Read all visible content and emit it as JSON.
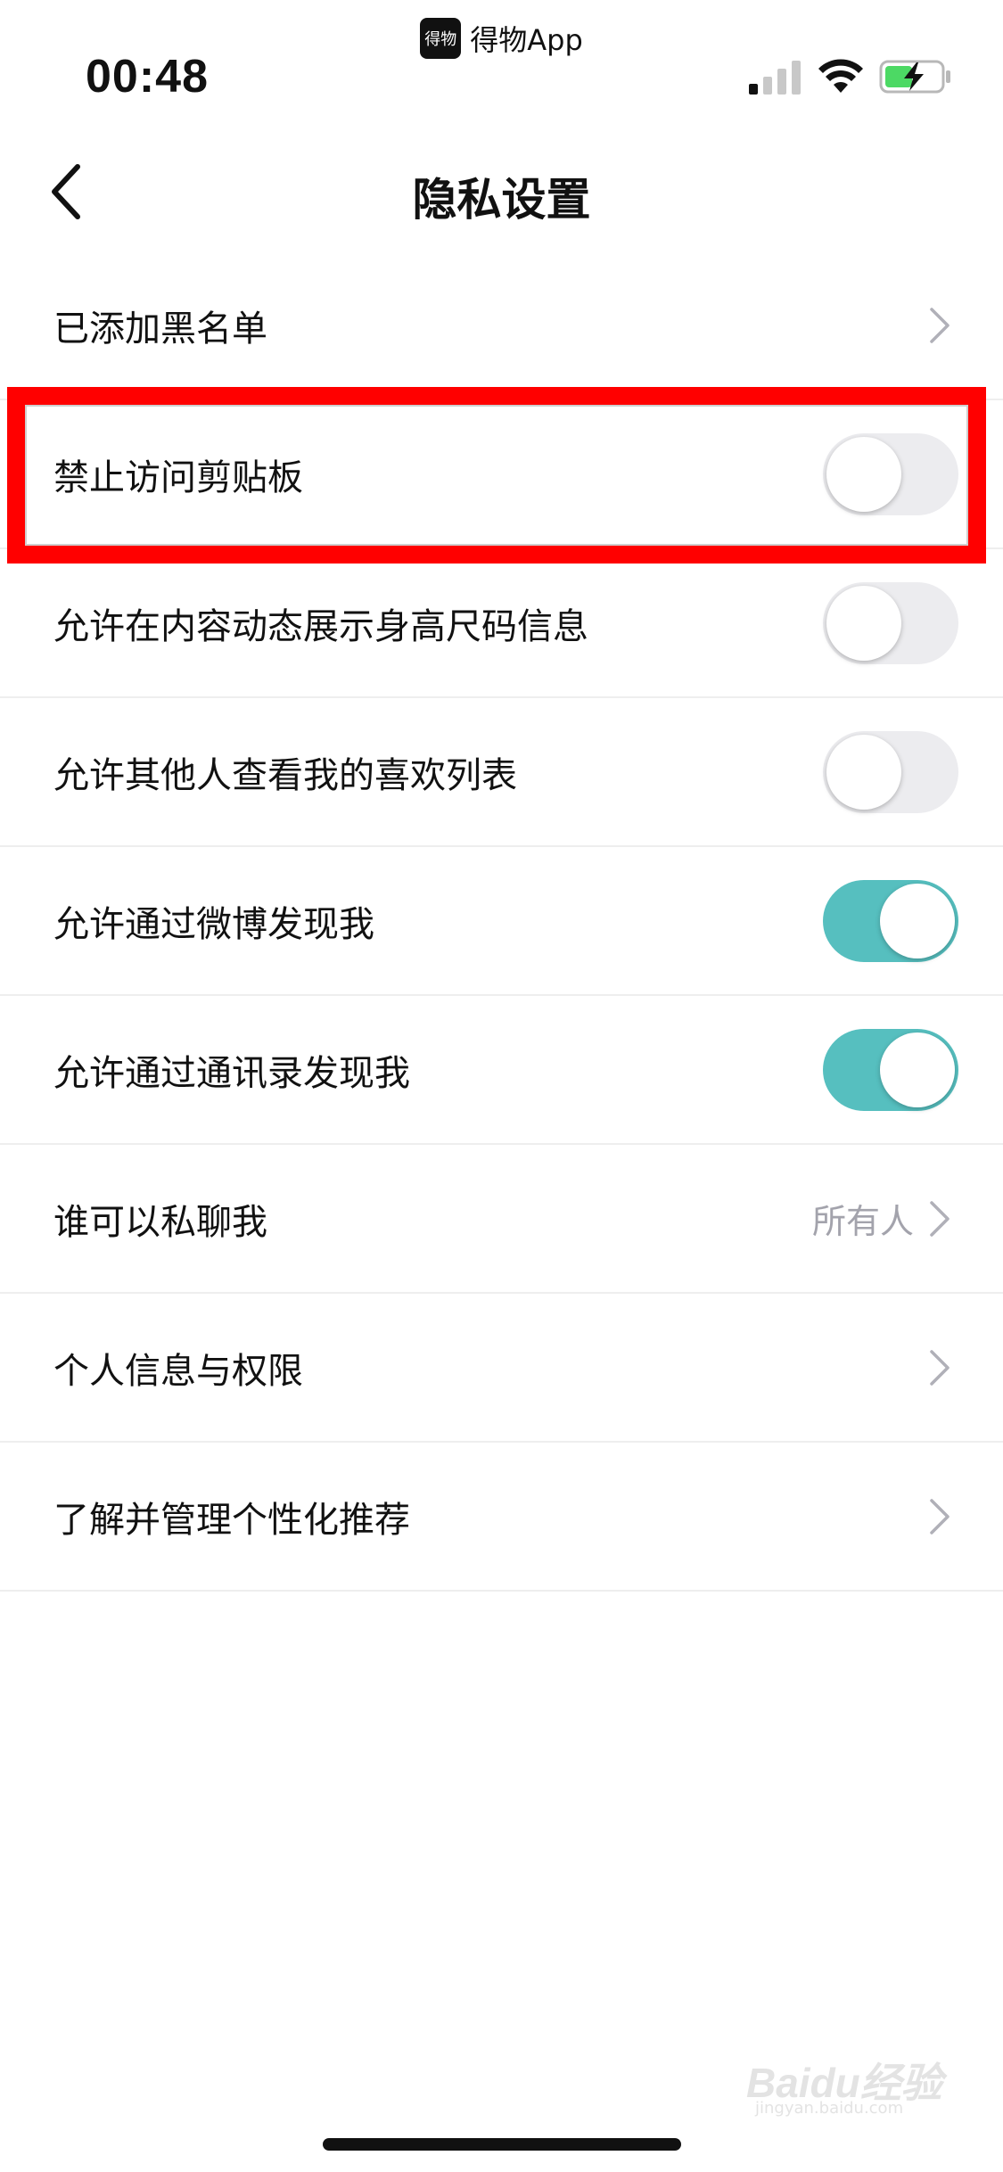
{
  "status_bar": {
    "app_logo_text": "得物",
    "app_name": "得物App",
    "time": "00:48",
    "signal_icon": "cellular-signal-icon",
    "wifi_icon": "wifi-icon",
    "battery_icon": "battery-charging-icon"
  },
  "nav": {
    "back_icon": "chevron-left-icon",
    "title": "隐私设置"
  },
  "settings": [
    {
      "label": "已添加黑名单",
      "type": "link"
    },
    {
      "label": "禁止访问剪贴板",
      "type": "toggle",
      "on": false
    },
    {
      "label": "允许在内容动态展示身高尺码信息",
      "type": "toggle",
      "on": false
    },
    {
      "label": "允许其他人查看我的喜欢列表",
      "type": "toggle",
      "on": false
    },
    {
      "label": "允许通过微博发现我",
      "type": "toggle",
      "on": true
    },
    {
      "label": "允许通过通讯录发现我",
      "type": "toggle",
      "on": true
    },
    {
      "label": "谁可以私聊我",
      "type": "link",
      "value": "所有人"
    },
    {
      "label": "个人信息与权限",
      "type": "link"
    },
    {
      "label": "了解并管理个性化推荐",
      "type": "link"
    }
  ],
  "colors": {
    "toggle_on": "#56bfbf",
    "toggle_off": "#ececef",
    "highlight": "#ff0000",
    "secondary_text": "#a3a3ac"
  },
  "watermark": {
    "brand": "Baidu经验",
    "url": "jingyan.baidu.com"
  }
}
